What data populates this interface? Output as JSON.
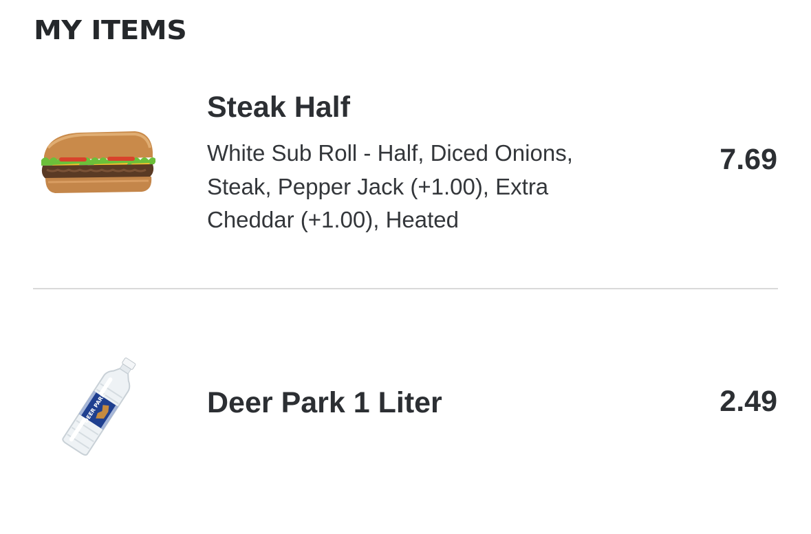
{
  "section": {
    "title": "MY ITEMS"
  },
  "items": [
    {
      "name": "Steak Half",
      "description": "White Sub Roll - Half, Diced Onions, Steak, Pepper Jack (+1.00), Extra Cheddar (+1.00), Heated",
      "price": "7.69",
      "image": "steak-sub-sandwich"
    },
    {
      "name": "Deer Park 1 Liter",
      "price": "2.49",
      "image": "deer-park-water-bottle",
      "label_brand": "DEER PARK"
    }
  ],
  "colors": {
    "text": "#2c2f33",
    "divider": "#d9d9d9",
    "label_blue": "#1f3f8f"
  }
}
